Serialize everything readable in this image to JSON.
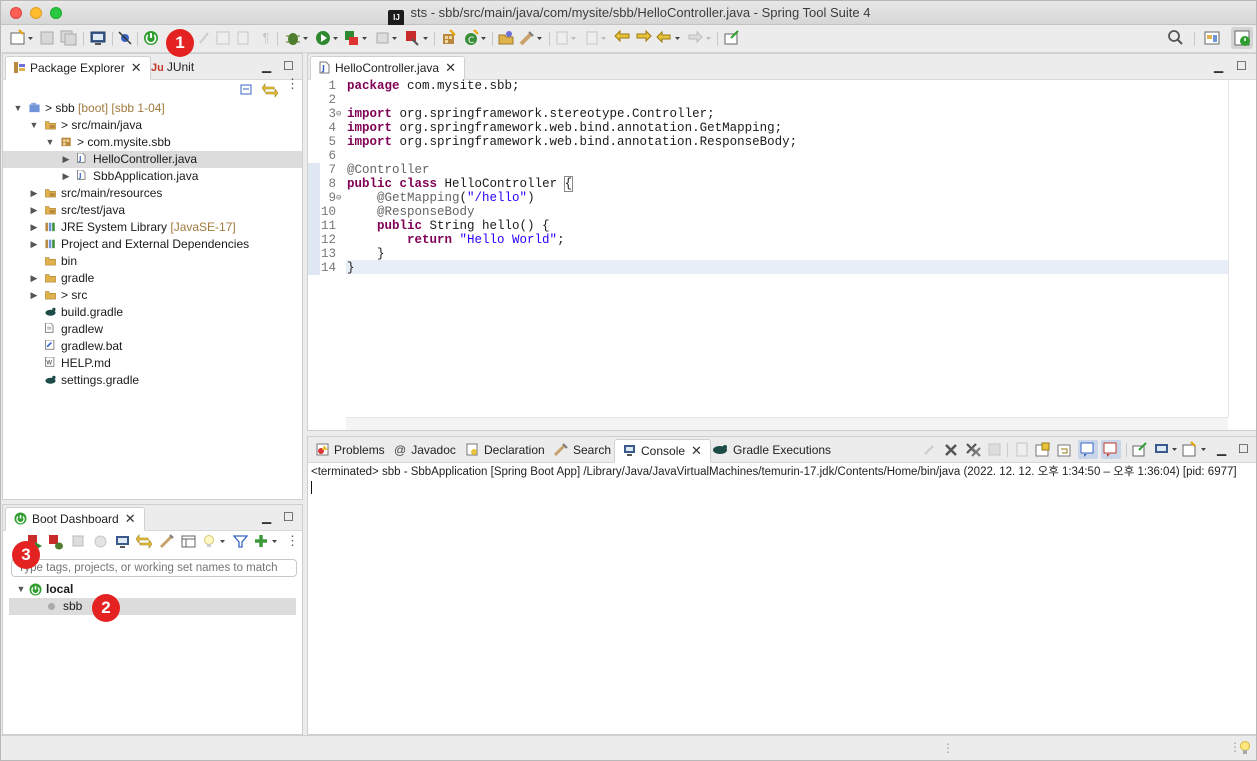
{
  "window": {
    "title": "sts - sbb/src/main/java/com/mysite/sbb/HelloController.java - Spring Tool Suite 4",
    "app_icon": "IJ"
  },
  "toolbar": {
    "icons": [
      "new-wizard-icon",
      "save-icon",
      "save-all-icon",
      "terminal-icon",
      "skip-breakpoints-icon",
      "boot-dashboard-icon",
      "annotation-icon",
      "toggle-icon",
      "build-icon",
      "debug-icon",
      "run-icon",
      "coverage-icon",
      "stop-icon",
      "external-tools-icon",
      "new-package-icon",
      "new-class-icon",
      "open-type-icon",
      "open-task-icon",
      "next-annotation-icon",
      "prev-annotation-icon",
      "last-edit-icon",
      "back-icon",
      "forward-icon",
      "open-perspective-icon",
      "search-icon",
      "perspective-java-icon",
      "perspective-spring-icon"
    ]
  },
  "explorer": {
    "tabs": [
      {
        "label": "Package Explorer"
      },
      {
        "label": "JUnit",
        "prefix": "Ju"
      }
    ],
    "tree": [
      {
        "label": "> sbb",
        "extra": "[boot] [sbb 1-04]",
        "level": 0,
        "expanded": true
      },
      {
        "label": "> src/main/java",
        "level": 1,
        "expanded": true
      },
      {
        "label": "> com.mysite.sbb",
        "level": 2,
        "expanded": true
      },
      {
        "label": "HelloController.java",
        "level": 3,
        "selected": true
      },
      {
        "label": "SbbApplication.java",
        "level": 3
      },
      {
        "label": "src/main/resources",
        "level": 1
      },
      {
        "label": "src/test/java",
        "level": 1
      },
      {
        "label": "JRE System Library",
        "extra": "[JavaSE-17]",
        "level": 1
      },
      {
        "label": "Project and External Dependencies",
        "level": 1
      },
      {
        "label": "bin",
        "level": 1
      },
      {
        "label": "gradle",
        "level": 1
      },
      {
        "label": "> src",
        "level": 1
      },
      {
        "label": "build.gradle",
        "level": 1
      },
      {
        "label": "gradlew",
        "level": 1
      },
      {
        "label": "gradlew.bat",
        "level": 1
      },
      {
        "label": "HELP.md",
        "level": 1
      },
      {
        "label": "settings.gradle",
        "level": 1
      }
    ]
  },
  "boot_dashboard": {
    "tab": "Boot Dashboard",
    "filter_placeholder": "Type tags, projects, or working set names to match",
    "group": "local",
    "app": "sbb"
  },
  "editor": {
    "tab": "HelloController.java",
    "lines": [
      {
        "n": "1",
        "code": "package com.mysite.sbb;"
      },
      {
        "n": "2",
        "code": ""
      },
      {
        "n": "3",
        "code": "import org.springframework.stereotype.Controller;"
      },
      {
        "n": "4",
        "code": "import org.springframework.web.bind.annotation.GetMapping;"
      },
      {
        "n": "5",
        "code": "import org.springframework.web.bind.annotation.ResponseBody;"
      },
      {
        "n": "6",
        "code": ""
      },
      {
        "n": "7",
        "code": "@Controller"
      },
      {
        "n": "8",
        "code": "public class HelloController {"
      },
      {
        "n": "9",
        "code": "    @GetMapping(\"/hello\")"
      },
      {
        "n": "10",
        "code": "    @ResponseBody"
      },
      {
        "n": "11",
        "code": "    public String hello() {"
      },
      {
        "n": "12",
        "code": "        return \"Hello World\";"
      },
      {
        "n": "13",
        "code": "    }"
      },
      {
        "n": "14",
        "code": "}"
      }
    ]
  },
  "console": {
    "tabs": [
      "Problems",
      "Javadoc",
      "Declaration",
      "Search",
      "Console",
      "Gradle Executions"
    ],
    "active": "Console",
    "status_line": "<terminated> sbb - SbbApplication [Spring Boot App] /Library/Java/JavaVirtualMachines/temurin-17.jdk/Contents/Home/bin/java  (2022. 12. 12. 오후 1:34:50 – 오후 1:36:04) [pid: 6977]"
  },
  "badges": [
    "1",
    "2",
    "3"
  ],
  "colors": {
    "keyword": "#7f0055",
    "string": "#2a00ff",
    "annotation": "#646464",
    "badge": "#e52222",
    "spring_green": "#2e9e2e"
  }
}
